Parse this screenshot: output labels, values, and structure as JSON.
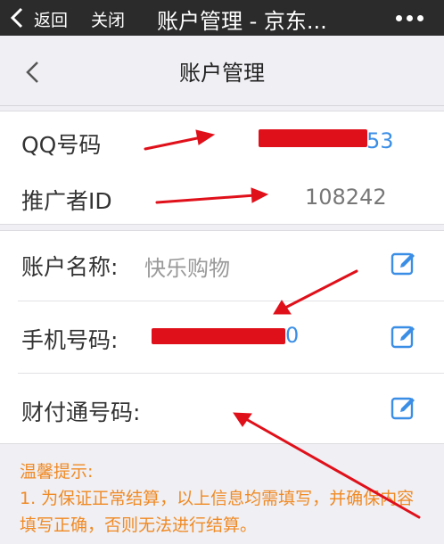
{
  "topbar": {
    "back_label": "返回",
    "close_label": "关闭",
    "title": "账户管理 - 京东...",
    "icons": {
      "back": "chevron-left-icon",
      "more": "more-dots-icon"
    }
  },
  "nav": {
    "title": "账户管理",
    "back_icon": "chevron-left-icon"
  },
  "account": {
    "qq_label": "QQ号码",
    "qq_value_visible_suffix": "53",
    "promoter_label": "推广者ID",
    "promoter_value": "108242"
  },
  "details": {
    "name_label": "账户名称:",
    "name_value": "快乐购物",
    "phone_label": "手机号码:",
    "phone_value_visible_suffix": "0",
    "tenpay_label": "财付通号码:",
    "edit_icon": "edit-icon"
  },
  "tip": {
    "title": "温馨提示:",
    "item1": "1. 为保证正常结算，以上信息均需填写，并确保内容填写正确，否则无法进行结算。"
  },
  "colors": {
    "accent_blue": "#3b8ee6",
    "tip_orange": "#f08a24",
    "annotation_red": "#e0101a",
    "topbar_bg": "#2b2b2b"
  }
}
